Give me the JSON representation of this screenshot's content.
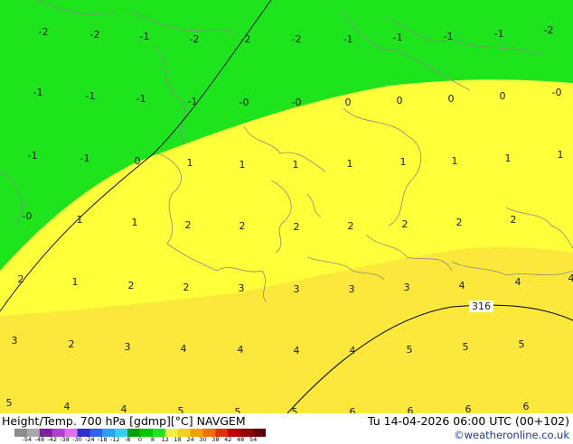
{
  "map": {
    "contour_label": "316",
    "temperature_labels": [
      "-2",
      "-2",
      "-1",
      "-2",
      "-2",
      "-2",
      "-1",
      "-1",
      "-1",
      "-1",
      "-2",
      "-1",
      "-1",
      "-1",
      "-1",
      "-0",
      "-0",
      "0",
      "0",
      "0",
      "0",
      "-0",
      "-1",
      "-1",
      "0",
      "1",
      "1",
      "1",
      "1",
      "1",
      "1",
      "1",
      "1",
      "-0",
      "1",
      "1",
      "2",
      "2",
      "2",
      "2",
      "2",
      "2",
      "2",
      "2",
      "1",
      "2",
      "2",
      "3",
      "3",
      "3",
      "3",
      "4",
      "4",
      "4",
      "3",
      "2",
      "3",
      "4",
      "4",
      "4",
      "4",
      "5",
      "5",
      "5",
      "5",
      "4",
      "4",
      "5",
      "5",
      "5",
      "6",
      "6",
      "6",
      "6"
    ]
  },
  "footer": {
    "title_left": "Height/Temp. 700 hPa [gdmp][°C] NAVGEM",
    "title_right": "Tu 14-04-2026 06:00 UTC (00+102)",
    "credit": "©weatheronline.co.uk",
    "colorbar_ticks": [
      "-54",
      "-48",
      "-42",
      "-38",
      "-30",
      "-24",
      "-18",
      "-12",
      "-8",
      "0",
      "8",
      "12",
      "18",
      "24",
      "30",
      "38",
      "42",
      "48",
      "54"
    ],
    "colorbar_colors": [
      "#8c8c8c",
      "#a9a9a9",
      "#7a1f9e",
      "#b040d0",
      "#e070f0",
      "#3030c8",
      "#3060f0",
      "#30a0f0",
      "#30d0f0",
      "#00a000",
      "#00c800",
      "#20e020",
      "#f0f040",
      "#f0d020",
      "#f0a000",
      "#f07000",
      "#e03000",
      "#c00000",
      "#900000",
      "#600000"
    ]
  }
}
